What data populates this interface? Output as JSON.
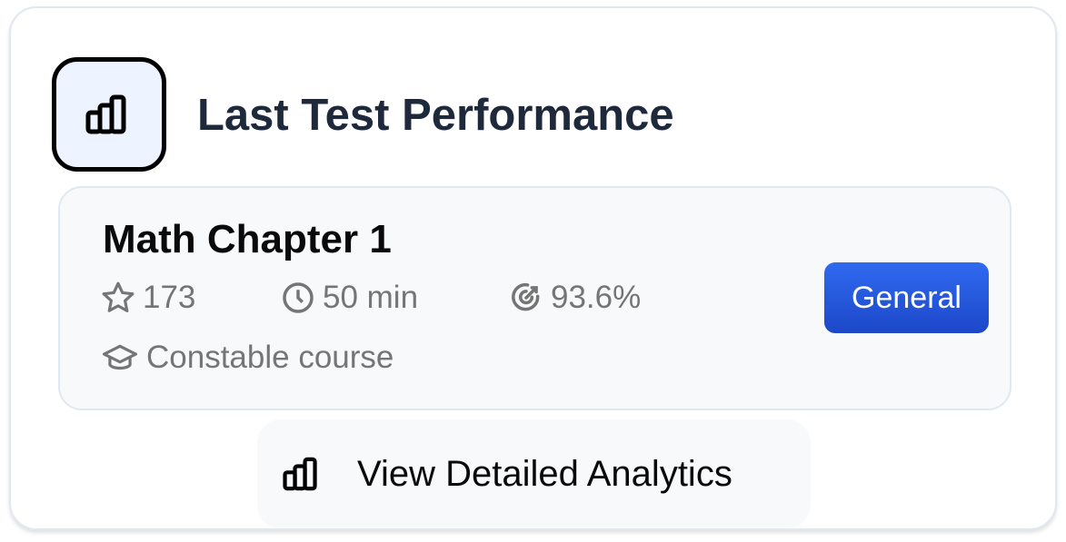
{
  "header": {
    "title": "Last Test Performance",
    "icon": "bar-chart-icon"
  },
  "test": {
    "name": "Math Chapter 1",
    "score": "173",
    "duration": "50 min",
    "accuracy": "93.6%",
    "course": "Constable course",
    "category": "General",
    "category_color": "#2563eb"
  },
  "action": {
    "label": "View Detailed Analytics",
    "icon": "bar-chart-icon"
  }
}
